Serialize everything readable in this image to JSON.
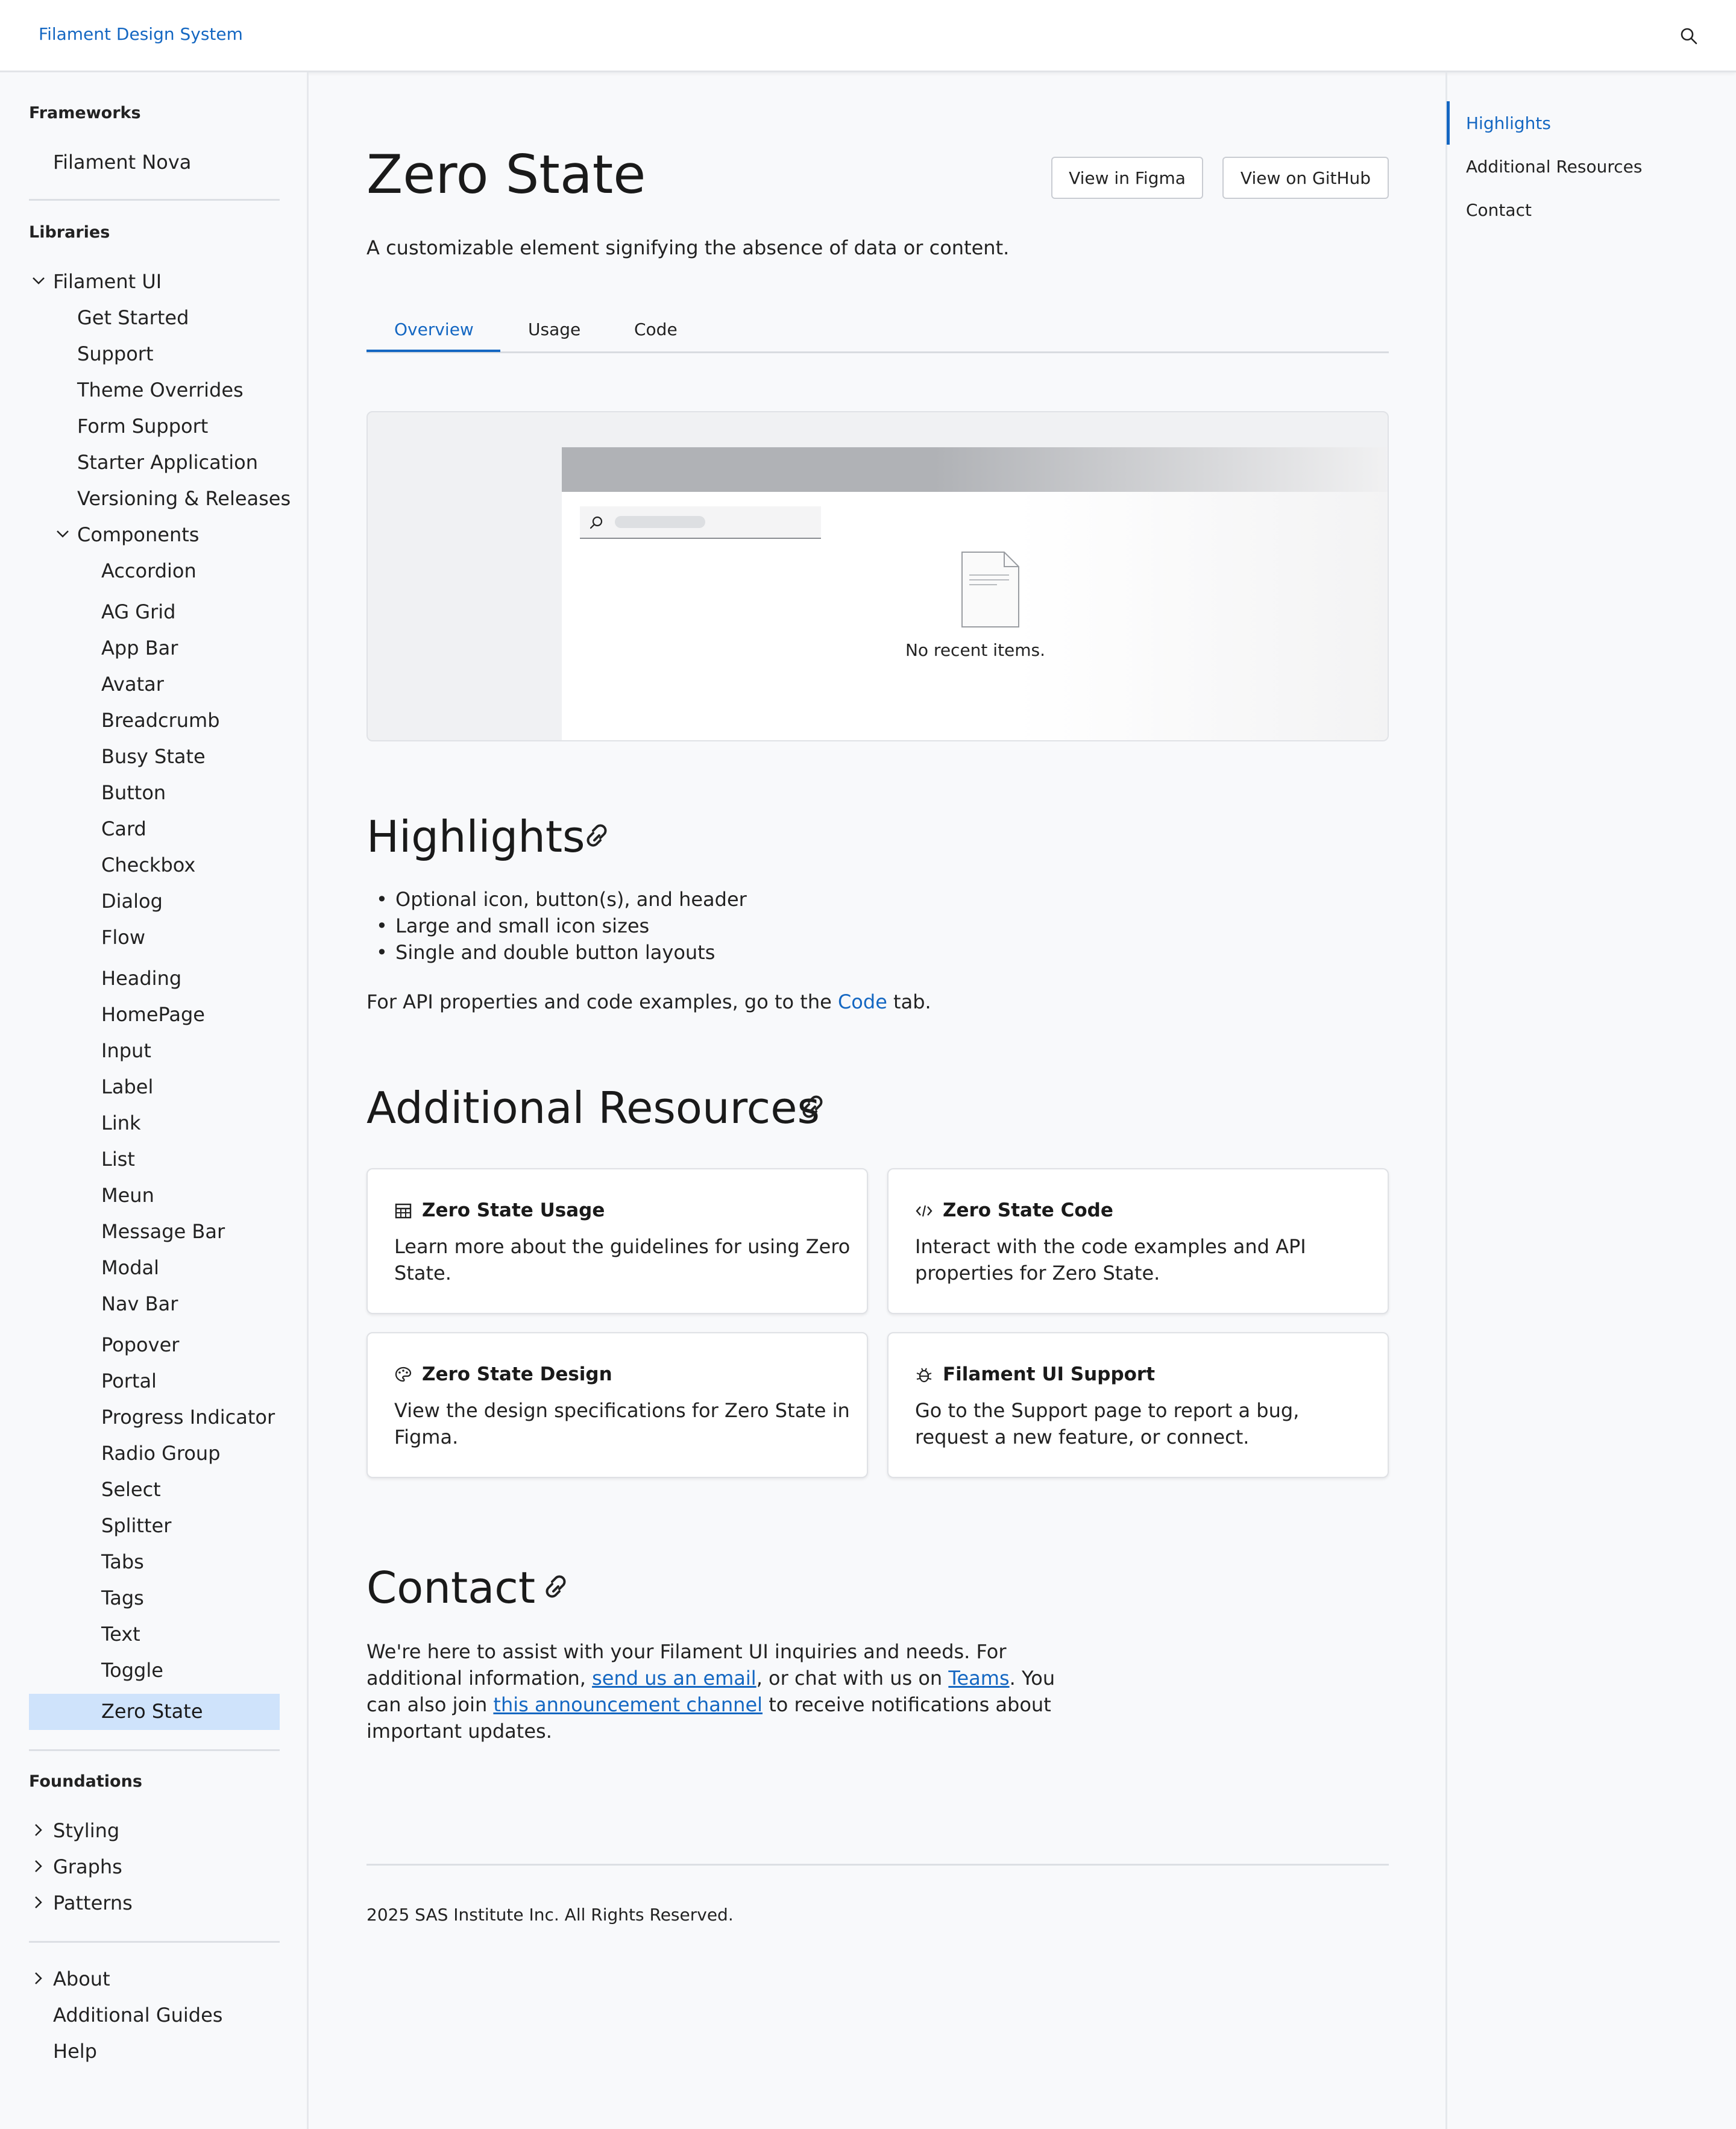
{
  "topbar": {
    "brand": "Filament Design System"
  },
  "sidebar": {
    "frameworks_heading": "Frameworks",
    "frameworks_items": [
      "Filament Nova"
    ],
    "libraries_heading": "Libraries",
    "filament_ui": "Filament UI",
    "filament_ui_children": [
      "Get Started",
      "Support",
      "Theme Overrides",
      "Form Support",
      "Starter Application",
      "Versioning & Releases"
    ],
    "components": "Components",
    "components_children": [
      "Accordion",
      "AG Grid",
      "App Bar",
      "Avatar",
      "Breadcrumb",
      "Busy State",
      "Button",
      "Card",
      "Checkbox",
      "Dialog",
      "Flow",
      "Heading",
      "HomePage",
      "Input",
      "Label",
      "Link",
      "List",
      "Meun",
      "Message Bar",
      "Modal",
      "Nav Bar",
      "Popover",
      "Portal",
      "Progress Indicator",
      "Radio Group",
      "Select",
      "Splitter",
      "Tabs",
      "Tags",
      "Text",
      "Toggle",
      "Zero State"
    ],
    "selected": "Zero State",
    "foundations_heading": "Foundations",
    "foundations_items": [
      "Styling",
      "Graphs",
      "Patterns"
    ],
    "about": "About",
    "bottom_items": [
      "Additional Guides",
      "Help"
    ]
  },
  "toc": {
    "items": [
      "Highlights",
      "Additional Resources",
      "Contact"
    ],
    "active": "Highlights"
  },
  "main": {
    "title": "Zero State",
    "view_figma": "View in Figma",
    "view_github": "View on GitHub",
    "subtitle": "A customizable element signifying the absence of data or content.",
    "tabs": [
      "Overview",
      "Usage",
      "Code"
    ],
    "active_tab": "Overview",
    "preview_message": "No recent items.",
    "highlights_heading": "Highlights",
    "highlights": [
      "Optional icon, button(s), and header",
      "Large and small icon sizes",
      "Single and double button layouts"
    ],
    "api_text_before": "For API properties and code examples, go to the ",
    "api_link": "Code",
    "api_text_after": " tab.",
    "resources_heading": "Additional Resources",
    "cards": [
      {
        "title": "Zero State Usage",
        "desc": "Learn more about the guidelines for using Zero State.",
        "icon": "table-icon"
      },
      {
        "title": "Zero State Code",
        "desc": "Interact with the code examples and API properties for Zero State.",
        "icon": "code-icon"
      },
      {
        "title": "Zero State Design",
        "desc": "View the design specifications for Zero State in Figma.",
        "icon": "palette-icon"
      },
      {
        "title": "Filament UI Support",
        "desc": "Go to the Support page to report a bug, request a new feature, or connect.",
        "icon": "bug-icon"
      }
    ],
    "contact_heading": "Contact",
    "contact_1": "We're here to assist with your Filament UI inquiries and needs. For additional information, ",
    "contact_email_link": "send us an email",
    "contact_2": ", or chat with us on ",
    "contact_teams_link": "Teams",
    "contact_3": ". You can also join ",
    "contact_channel_link": "this announcement channel",
    "contact_4": " to receive notifications about important updates.",
    "footer": "2025 SAS Institute Inc. All Rights Reserved."
  },
  "colors": {
    "accent": "#1467c2",
    "selected_bg": "#cfe3fb",
    "page_bg": "#f8f9fb"
  }
}
